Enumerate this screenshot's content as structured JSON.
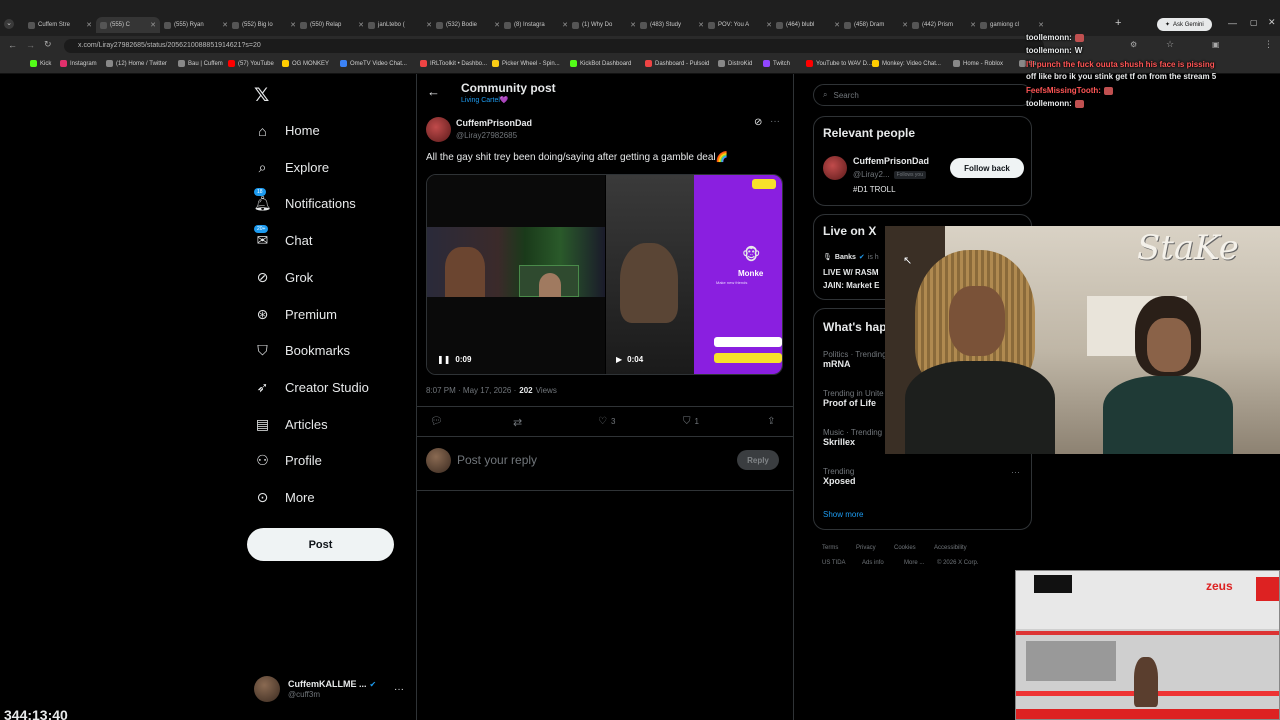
{
  "browser": {
    "tabs": [
      {
        "label": "Cuffem Stre"
      },
      {
        "label": "(555) C"
      },
      {
        "label": "(555) Ryan"
      },
      {
        "label": "(552) Big lo"
      },
      {
        "label": "(550) Relap"
      },
      {
        "label": "janLtebo ("
      },
      {
        "label": "(532) Bodie"
      },
      {
        "label": "(8) Instagra"
      },
      {
        "label": "(1) Why Do"
      },
      {
        "label": "(483) Study"
      },
      {
        "label": "POV: You A"
      },
      {
        "label": "(464) blubl"
      },
      {
        "label": "(458) Dram"
      },
      {
        "label": "(442) Prism"
      },
      {
        "label": "gamiong cl"
      }
    ],
    "ask_gemini": "Ask Gemini",
    "url": "x.com/Liray27982685/status/2056210088851914621?s=20",
    "bookmarks": [
      {
        "label": "Kick",
        "color": "#53fc18"
      },
      {
        "label": "Instagram",
        "color": "#e1306c"
      },
      {
        "label": "(12) Home / Twitter",
        "color": "#888"
      },
      {
        "label": "Bau | Cuffem",
        "color": "#888"
      },
      {
        "label": "(57) YouTube",
        "color": "#ff0000"
      },
      {
        "label": "OG MONKEY",
        "color": "#ffcc00"
      },
      {
        "label": "OmeTV Video Chat...",
        "color": "#3b82f6"
      },
      {
        "label": "IRLToolkit • Dashbo...",
        "color": "#ef4444"
      },
      {
        "label": "Picker Wheel - Spin...",
        "color": "#facc15"
      },
      {
        "label": "KickBot Dashboard",
        "color": "#53fc18"
      },
      {
        "label": "Dashboard - Pulsoid",
        "color": "#ef4444"
      },
      {
        "label": "DistroKid",
        "color": "#888"
      },
      {
        "label": "Twitch",
        "color": "#9146ff"
      },
      {
        "label": "YouTube to WAV D...",
        "color": "#ff0000"
      },
      {
        "label": "Monkey: Video Chat...",
        "color": "#ffcc00"
      },
      {
        "label": "Home - Roblox",
        "color": "#888"
      },
      {
        "label": "Ba",
        "color": "#888"
      }
    ]
  },
  "nav": {
    "items": [
      {
        "label": "Home",
        "icon": "home-icon"
      },
      {
        "label": "Explore",
        "icon": "search-icon"
      },
      {
        "label": "Notifications",
        "icon": "bell-icon",
        "badge": "18"
      },
      {
        "label": "Chat",
        "icon": "mail-icon",
        "badge": "20+"
      },
      {
        "label": "Grok",
        "icon": "grok-icon"
      },
      {
        "label": "Premium",
        "icon": "x-premium-icon"
      },
      {
        "label": "Bookmarks",
        "icon": "bookmark-icon"
      },
      {
        "label": "Creator Studio",
        "icon": "rocket-icon"
      },
      {
        "label": "Articles",
        "icon": "article-icon"
      },
      {
        "label": "Profile",
        "icon": "person-icon"
      },
      {
        "label": "More",
        "icon": "more-circle-icon"
      }
    ],
    "post_label": "Post",
    "account_name": "CuffemKALLME ...",
    "account_handle": "@cuff3m"
  },
  "post": {
    "header_title": "Community post",
    "community": "Living Cartel💜",
    "author_name": "CuffemPrisonDad",
    "author_handle": "@Liray27982685",
    "text": "All the gay shit trey been doing/saying after getting a gamble deal🌈",
    "video1_duration": "0:09",
    "video2_duration": "0:04",
    "video2_overlay": "Monke",
    "video2_sub": "Make new friends",
    "time": "8:07 PM · May 17, 2026 ·",
    "views_count": "202",
    "views_label": "Views",
    "likes": "3",
    "bookmarks": "1",
    "reply_placeholder": "Post your reply",
    "reply_button": "Reply"
  },
  "sidebar": {
    "search_placeholder": "Search",
    "relevant_title": "Relevant people",
    "person_name": "CuffemPrisonDad",
    "person_handle": "@Liray2...",
    "follows_you": "Follows you",
    "person_bio": "#D1 TROLL",
    "follow_back": "Follow back",
    "live_title": "Live on X",
    "live_user": "Banks",
    "live_user_suffix": "is h",
    "live_text_1": "LIVE W/ RASM",
    "live_text_2": "JAIN: Market E",
    "happening_title": "What's hap",
    "trends": [
      {
        "category": "Politics · Trending",
        "name": "mRNA"
      },
      {
        "category": "Trending in Unite",
        "name": "Proof of Life"
      },
      {
        "category": "Music · Trending",
        "name": "Skrillex"
      },
      {
        "category": "Trending",
        "name": "Xposed"
      }
    ],
    "show_more": "Show more",
    "footer": [
      "Terms",
      "Privacy",
      "Cookies",
      "Accessibility",
      "US TIDA",
      "Ads info",
      "More ...",
      "© 2026 X Corp."
    ]
  },
  "chat_overlay": [
    {
      "user": "toollemonn:",
      "msg": "",
      "color": "#e7e9ea"
    },
    {
      "user": "toollemonn:",
      "msg": "W",
      "color": "#e7e9ea"
    },
    {
      "user": "",
      "msg": "I'll punch the fuck ouuta shush his face is pissing",
      "color": "#ff5555"
    },
    {
      "user": "",
      "msg": "off like bro ik you stink get tf on from the stream 5",
      "color": "#e7e9ea"
    },
    {
      "user": "FeefsMissingTooth:",
      "msg": "",
      "color": "#ff5555"
    },
    {
      "user": "toollemonn:",
      "msg": "",
      "color": "#e7e9ea"
    }
  ],
  "stream_timer": "344:13:40",
  "cam_logo": "StaKe",
  "zeus_label": "zeus"
}
